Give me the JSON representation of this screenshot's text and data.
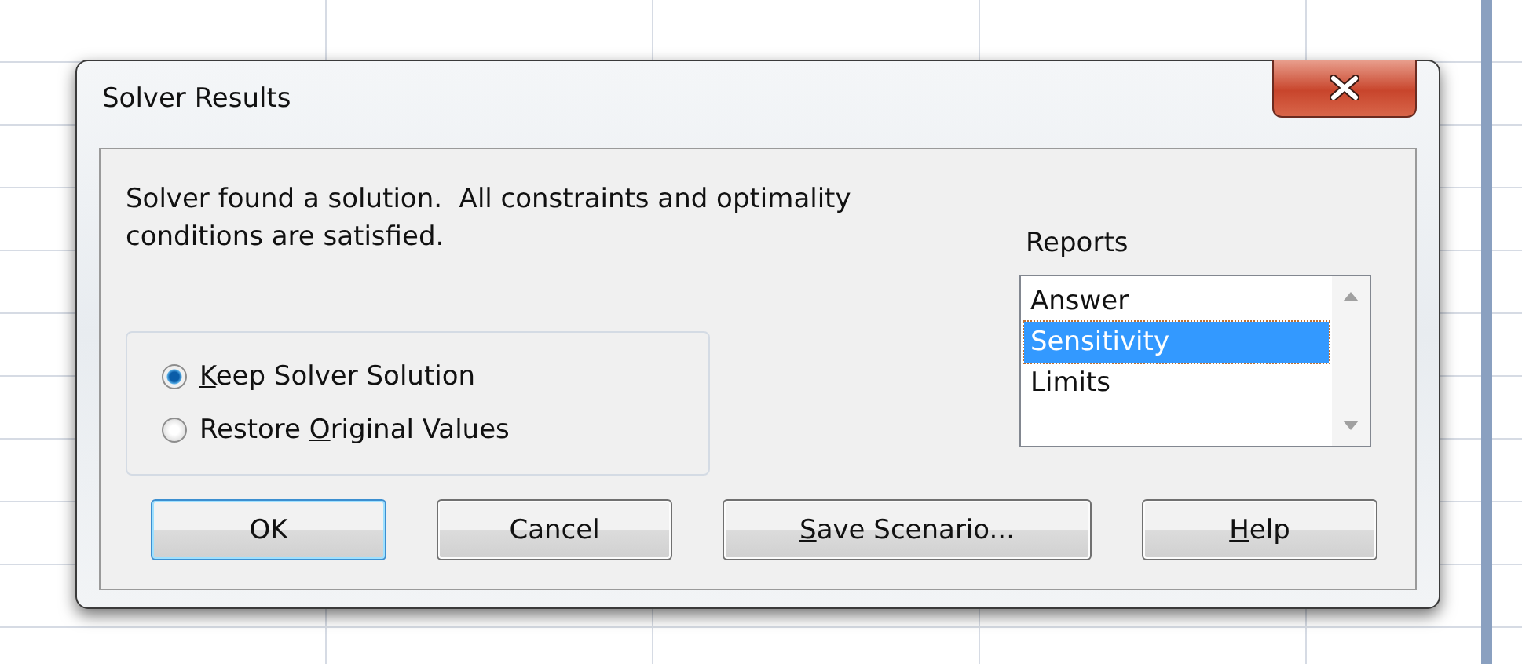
{
  "window": {
    "title": "Solver Results"
  },
  "message": "Solver found a solution.  All constraints and optimality conditions are satisfied.",
  "options": [
    {
      "access_key": "K",
      "label_rest": "eep Solver Solution",
      "selected": true
    },
    {
      "label_start": "Restore ",
      "access_key": "O",
      "label_rest": "riginal Values",
      "selected": false
    }
  ],
  "reports": {
    "label": "Reports",
    "items": [
      {
        "label": "Answer",
        "selected": false
      },
      {
        "label": "Sensitivity",
        "selected": true
      },
      {
        "label": "Limits",
        "selected": false
      }
    ]
  },
  "buttons": [
    {
      "label_rest": "OK",
      "default": true
    },
    {
      "label_rest": "Cancel",
      "default": false
    },
    {
      "access_key": "S",
      "label_rest": "ave Scenario...",
      "default": false
    },
    {
      "access_key": "H",
      "label_rest": "elp",
      "default": false
    }
  ]
}
